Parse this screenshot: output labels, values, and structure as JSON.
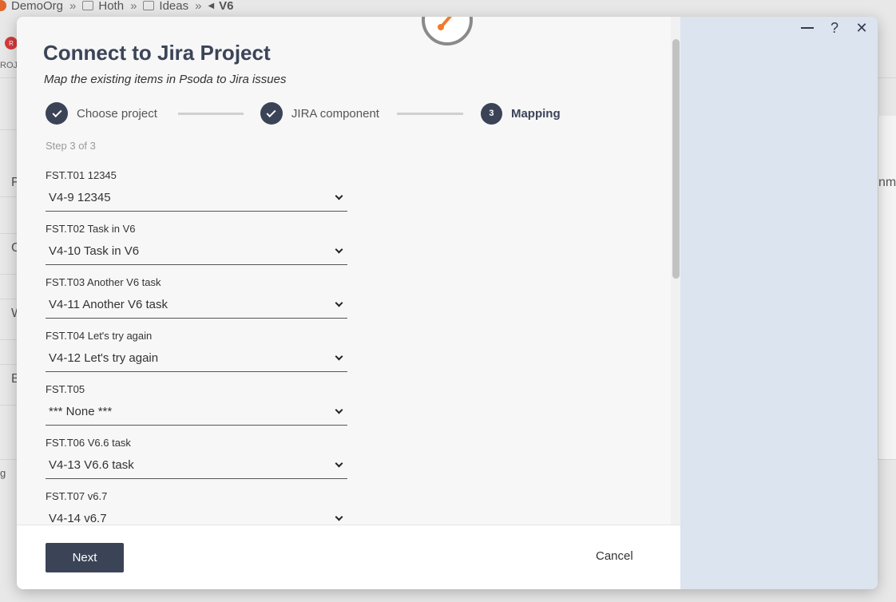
{
  "background": {
    "breadcrumb": [
      "DemoOrg",
      "Hoth",
      "Ideas",
      "V6"
    ],
    "badge": "R",
    "side_text": "ROJ",
    "letters": [
      "F",
      "C",
      "W",
      "B"
    ],
    "bottom_text": "g",
    "right_text": "nm"
  },
  "dialog": {
    "title": "Connect to Jira Project",
    "subtitle": "Map the existing items in Psoda to Jira issues",
    "window": {
      "minimize": "—",
      "help": "?",
      "close": "✕"
    },
    "steps": [
      {
        "label": "Choose project",
        "state": "done"
      },
      {
        "label": "JIRA component",
        "state": "done"
      },
      {
        "label": "Mapping",
        "number": "3",
        "state": "active"
      }
    ],
    "step_count": "Step 3 of 3",
    "mappings": [
      {
        "label": "FST.T01 12345",
        "value": "V4-9 12345"
      },
      {
        "label": "FST.T02 Task in V6",
        "value": "V4-10 Task in V6"
      },
      {
        "label": "FST.T03 Another V6 task",
        "value": "V4-11 Another V6 task"
      },
      {
        "label": "FST.T04 Let's try again",
        "value": "V4-12 Let's try again"
      },
      {
        "label": "FST.T05",
        "value": "*** None ***"
      },
      {
        "label": "FST.T06 V6.6 task",
        "value": "V4-13 V6.6 task"
      },
      {
        "label": "FST.T07 v6.7",
        "value": "V4-14 v6.7"
      }
    ],
    "next_label": "Next",
    "cancel_label": "Cancel"
  },
  "colors": {
    "primary": "#3b4357",
    "right_panel": "#dbe4ef",
    "logo_orange": "#f07c2a"
  }
}
